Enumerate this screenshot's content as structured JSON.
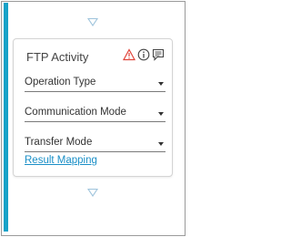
{
  "activity": {
    "title": "FTP Activity",
    "icons": [
      "warning-icon",
      "info-icon",
      "comment-icon"
    ],
    "fields": [
      {
        "label": "Operation Type",
        "value": ""
      },
      {
        "label": "Communication Mode",
        "value": ""
      },
      {
        "label": "Transfer Mode",
        "value": ""
      }
    ],
    "link_label": "Result Mapping"
  },
  "colors": {
    "accent": "#17a2c8",
    "link": "#1a8fc7",
    "warning": "#e0443a",
    "connector": "#9fc4dc"
  }
}
